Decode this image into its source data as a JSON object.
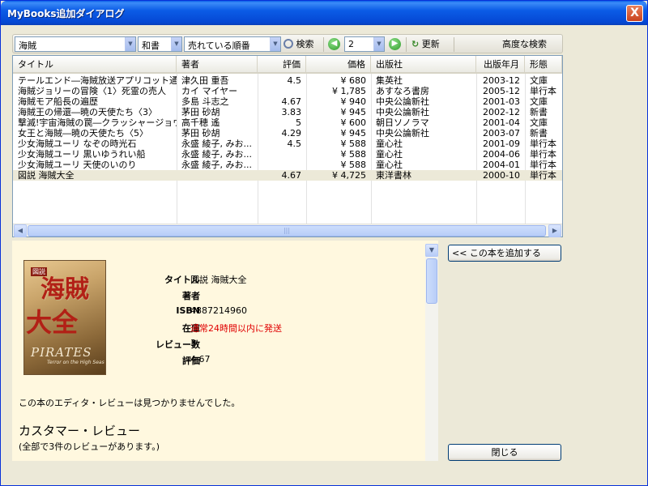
{
  "window": {
    "title": "MyBooks追加ダイアログ",
    "close_label": "X"
  },
  "toolbar": {
    "keyword": "海賊",
    "category": "和書",
    "sort": "売れている順番",
    "search_label": "検索",
    "page": "2",
    "refresh_label": "更新",
    "advanced_label": "高度な検索"
  },
  "table": {
    "headers": [
      "タイトル",
      "著者",
      "評価",
      "価格",
      "出版社",
      "出版年月",
      "形態"
    ],
    "rows": [
      [
        "テールエンド―海賊放送アプリコット通信",
        "津久田 重吾",
        "4.5",
        "¥ 680",
        "集英社",
        "2003-12",
        "文庫"
      ],
      [
        "海賊ジョリーの冒険〈1〉死霊の売人",
        "カイ マイヤー",
        "",
        "¥ 1,785",
        "あすなろ書房",
        "2005-12",
        "単行本"
      ],
      [
        "海賊モア船長の遍歴",
        "多島 斗志之",
        "4.67",
        "¥ 940",
        "中央公論新社",
        "2001-03",
        "文庫"
      ],
      [
        "海賊王の帰還―暁の天使たち〈3〉",
        "茅田 砂胡",
        "3.83",
        "¥ 945",
        "中央公論新社",
        "2002-12",
        "新書"
      ],
      [
        "撃滅!宇宙海賊の罠―クラッシャージョウ...",
        "高千穂 遙",
        "5",
        "¥ 600",
        "朝日ソノラマ",
        "2001-04",
        "文庫"
      ],
      [
        "女王と海賊―暁の天使たち〈5〉",
        "茅田 砂胡",
        "4.29",
        "¥ 945",
        "中央公論新社",
        "2003-07",
        "新書"
      ],
      [
        "少女海賊ユーリ なぞの時光石",
        "永盛 綾子, みお...",
        "4.5",
        "¥ 588",
        "童心社",
        "2001-09",
        "単行本"
      ],
      [
        "少女海賊ユーリ 黒いゆうれい船",
        "永盛 綾子, みお...",
        "",
        "¥ 588",
        "童心社",
        "2004-06",
        "単行本"
      ],
      [
        "少女海賊ユーリ 天使のいのり",
        "永盛 綾子, みお...",
        "",
        "¥ 588",
        "童心社",
        "2004-01",
        "単行本"
      ],
      [
        "図説 海賊大全",
        "",
        "4.67",
        "¥ 4,725",
        "東洋書林",
        "2000-10",
        "単行本"
      ]
    ],
    "selected_index": 9
  },
  "detail": {
    "cover": {
      "badge": "図説",
      "kanji1": "海賊",
      "kanji2": "大全",
      "english": "PIRATES",
      "english_sub": "Terror on the High Seas"
    },
    "fields": [
      {
        "label": "タイトル",
        "value": "図説 海賊大全"
      },
      {
        "label": "著者",
        "value": ""
      },
      {
        "label": "ISBN",
        "value": "4887214960"
      },
      {
        "label": "在庫",
        "value": "通常24時間以内に発送",
        "color": "#e00000"
      },
      {
        "label": "レビュー数",
        "value": "3"
      },
      {
        "label": "評価",
        "value": "4.67"
      }
    ],
    "editorial_note": "この本のエディタ・レビューは見つかりませんでした。",
    "customer_heading": "カスタマー・レビュー",
    "customer_count": "(全部で3件のレビューがあります。)"
  },
  "buttons": {
    "add_label": "<< この本を追加する",
    "close_label": "閉じる"
  }
}
